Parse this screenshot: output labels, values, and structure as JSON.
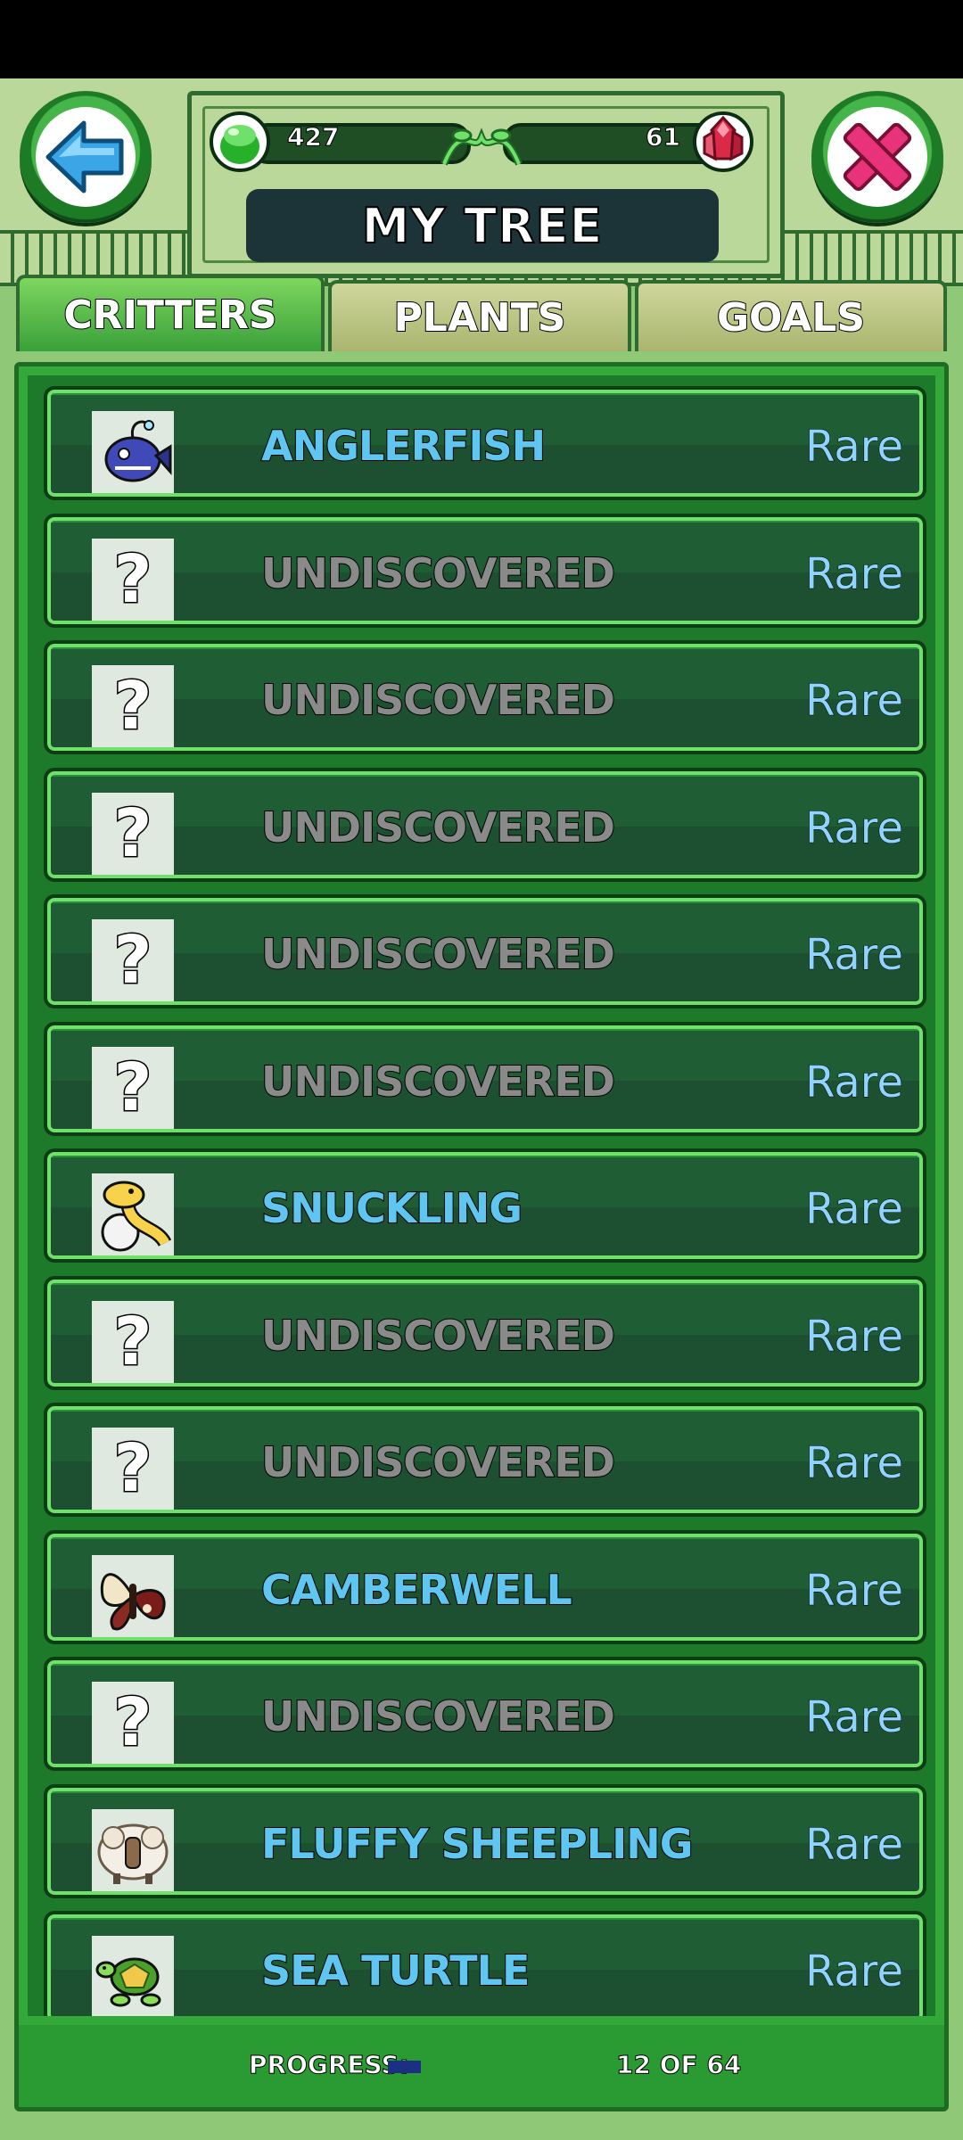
{
  "header": {
    "title": "MY TREE",
    "green_gems": "427",
    "red_gems": "61"
  },
  "icons": {
    "back": "back-arrow-icon",
    "close": "close-x-icon",
    "green_gem": "green-gem-icon",
    "red_gem": "red-crystal-icon"
  },
  "tabs": [
    {
      "label": "CRITTERS",
      "active": true
    },
    {
      "label": "PLANTS",
      "active": false
    },
    {
      "label": "GOALS",
      "active": false
    }
  ],
  "critters": [
    {
      "name": "ANGLERFISH",
      "rarity": "Rare",
      "discovered": true,
      "icon": "anglerfish-icon"
    },
    {
      "name": "UNDISCOVERED",
      "rarity": "Rare",
      "discovered": false,
      "icon": "question-mark-icon"
    },
    {
      "name": "UNDISCOVERED",
      "rarity": "Rare",
      "discovered": false,
      "icon": "question-mark-icon"
    },
    {
      "name": "UNDISCOVERED",
      "rarity": "Rare",
      "discovered": false,
      "icon": "question-mark-icon"
    },
    {
      "name": "UNDISCOVERED",
      "rarity": "Rare",
      "discovered": false,
      "icon": "question-mark-icon"
    },
    {
      "name": "UNDISCOVERED",
      "rarity": "Rare",
      "discovered": false,
      "icon": "question-mark-icon"
    },
    {
      "name": "SNUCKLING",
      "rarity": "Rare",
      "discovered": true,
      "icon": "snuckling-icon"
    },
    {
      "name": "UNDISCOVERED",
      "rarity": "Rare",
      "discovered": false,
      "icon": "question-mark-icon"
    },
    {
      "name": "UNDISCOVERED",
      "rarity": "Rare",
      "discovered": false,
      "icon": "question-mark-icon"
    },
    {
      "name": "CAMBERWELL",
      "rarity": "Rare",
      "discovered": true,
      "icon": "camberwell-icon"
    },
    {
      "name": "UNDISCOVERED",
      "rarity": "Rare",
      "discovered": false,
      "icon": "question-mark-icon"
    },
    {
      "name": "FLUFFY SHEEPLING",
      "rarity": "Rare",
      "discovered": true,
      "icon": "sheepling-icon"
    },
    {
      "name": "SEA TURTLE",
      "rarity": "Rare",
      "discovered": true,
      "icon": "sea-turtle-icon"
    }
  ],
  "footer": {
    "progress_label": "PROGRESS:",
    "progress_count": "12 OF 64",
    "progress_fraction": 0.1875
  },
  "colors": {
    "known_name": "#5fc6f2",
    "unknown_name": "#8a8a8a",
    "rarity": "#8fd3ff",
    "progress_fill": "#1b2f85"
  }
}
